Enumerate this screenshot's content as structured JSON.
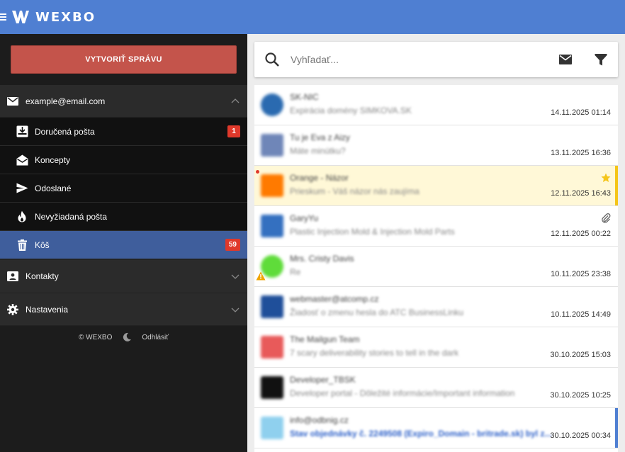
{
  "app": {
    "brand": "WEXBO"
  },
  "sidebar": {
    "compose_label": "VYTVORIŤ SPRÁVU",
    "account": "example@email.com",
    "folders": [
      {
        "label": "Doručená pošta",
        "badge": "1",
        "icon": "inbox-icon"
      },
      {
        "label": "Koncepty",
        "badge": "",
        "icon": "drafts-icon"
      },
      {
        "label": "Odoslané",
        "badge": "",
        "icon": "send-icon"
      },
      {
        "label": "Nevyžiadaná pošta",
        "badge": "",
        "icon": "fire-icon"
      },
      {
        "label": "Kôš",
        "badge": "59",
        "icon": "trash-icon",
        "active": true
      }
    ],
    "contacts_label": "Kontakty",
    "settings_label": "Nastavenia",
    "footer_copyright": "© WEXBO",
    "footer_logout": "Odhlásiť"
  },
  "search": {
    "placeholder": "Vyhľadať..."
  },
  "colors": {
    "topbar": "#4f7fd2",
    "accent": "#3f5e9c",
    "compose": "#c4544b",
    "badge": "#e0392b",
    "flag": "#f5c518",
    "unread_bar": "#4f7fd2"
  },
  "messages": [
    {
      "sender": "SK-NIC",
      "preview": "Expirácia domény SIMKOVA.SK",
      "date": "14.11.2025 01:14"
    },
    {
      "sender": "Tu je Eva z Aizy",
      "preview": "Máte minútku?",
      "date": "13.11.2025 16:36"
    },
    {
      "sender": "Orange - Názor",
      "preview": "Prieskum - Váš názor nás zaujíma",
      "date": "12.11.2025 16:43",
      "flagged": true
    },
    {
      "sender": "GaryYu",
      "preview": "Plastic Injection Mold & Injection Mold Parts",
      "date": "12.11.2025 00:22",
      "attachment": true
    },
    {
      "sender": "Mrs. Cristy Davis",
      "preview": "Re",
      "date": "10.11.2025 23:38",
      "warning": true
    },
    {
      "sender": "webmaster@atcomp.cz",
      "preview": "Žiadosť o zmenu hesla do ATC BusinessLinku",
      "date": "10.11.2025 14:49"
    },
    {
      "sender": "The Mailgun Team",
      "preview": "7 scary deliverability stories to tell in the dark",
      "date": "30.10.2025 15:03"
    },
    {
      "sender": "Developer_TBSK",
      "preview": "Developer portal - Dôležité informácie/Important information",
      "date": "30.10.2025 10:25"
    },
    {
      "sender": "info@odbnig.cz",
      "preview": "Stav objednávky č. 2249508 (Expiro_Domain - britrade.sk) byl z...",
      "date": "30.10.2025 00:34",
      "unread": true
    }
  ]
}
